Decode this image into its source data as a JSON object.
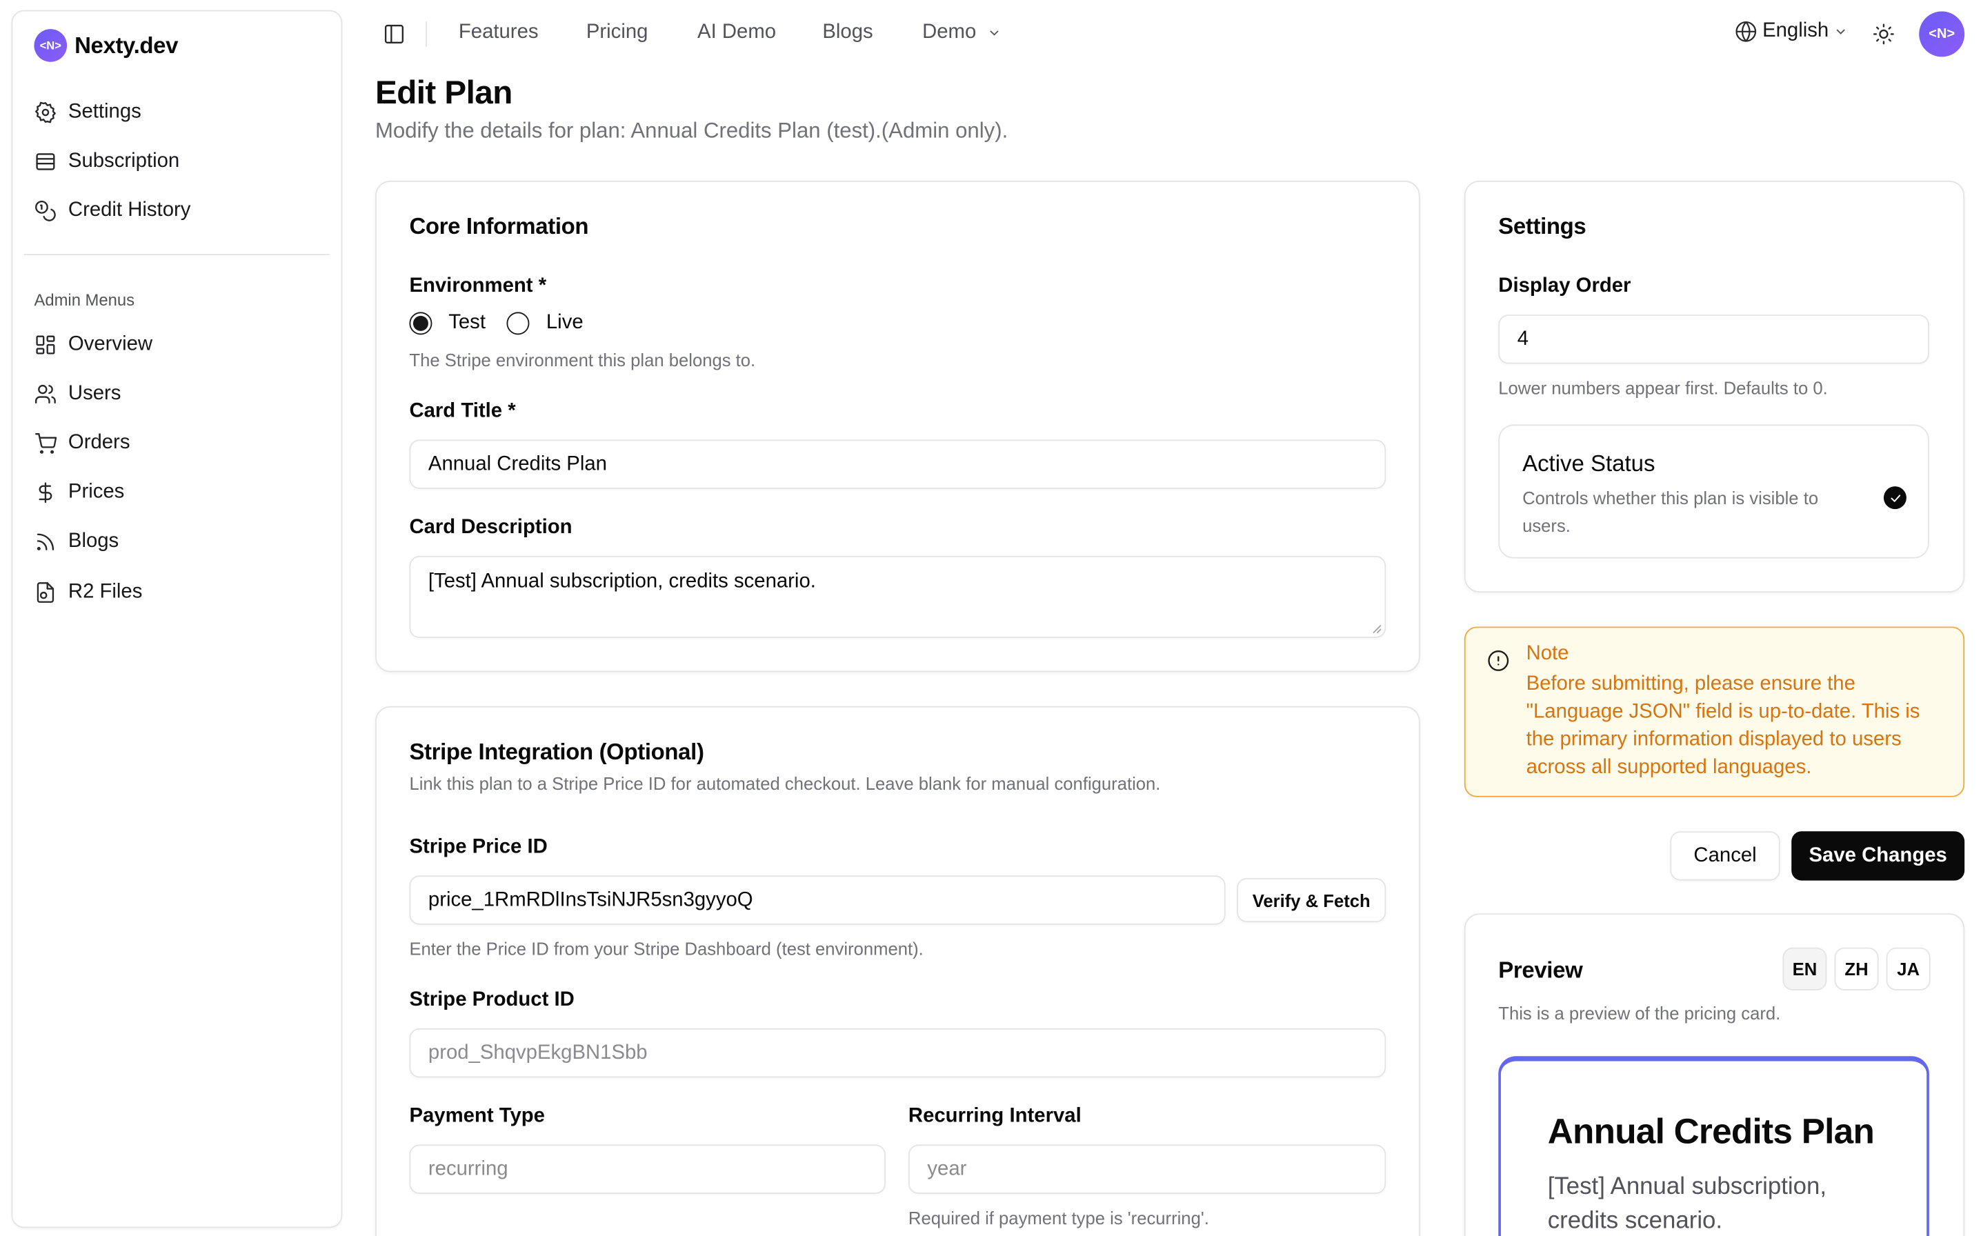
{
  "brand": {
    "name": "Nexty.dev",
    "logo_text": "<N>"
  },
  "sidebar": {
    "items": [
      {
        "label": "Settings",
        "icon": "gear-icon"
      },
      {
        "label": "Subscription",
        "icon": "card-icon"
      },
      {
        "label": "Credit History",
        "icon": "coins-icon"
      }
    ],
    "admin_label": "Admin Menus",
    "admin_items": [
      {
        "label": "Overview",
        "icon": "grid-icon"
      },
      {
        "label": "Users",
        "icon": "users-icon"
      },
      {
        "label": "Orders",
        "icon": "cart-icon"
      },
      {
        "label": "Prices",
        "icon": "dollar-icon"
      },
      {
        "label": "Blogs",
        "icon": "rss-icon"
      },
      {
        "label": "R2 Files",
        "icon": "file-icon"
      }
    ]
  },
  "topnav": {
    "items": [
      "Features",
      "Pricing",
      "AI Demo",
      "Blogs"
    ],
    "demo": "Demo",
    "language": "English",
    "avatar_text": "<N>"
  },
  "page": {
    "title": "Edit Plan",
    "subtitle": "Modify the details for plan: Annual Credits Plan (test).(Admin only)."
  },
  "core": {
    "title": "Core Information",
    "environment_label": "Environment *",
    "env_options": [
      "Test",
      "Live"
    ],
    "env_selected": "Test",
    "environment_help": "The Stripe environment this plan belongs to.",
    "card_title_label": "Card Title *",
    "card_title_value": "Annual Credits Plan",
    "card_desc_label": "Card Description",
    "card_desc_value": "[Test] Annual subscription, credits scenario."
  },
  "stripe": {
    "title": "Stripe Integration (Optional)",
    "description": "Link this plan to a Stripe Price ID for automated checkout. Leave blank for manual configuration.",
    "price_id_label": "Stripe Price ID",
    "price_id_value": "price_1RmRDlInsTsiNJR5sn3gyyoQ",
    "verify_button": "Verify & Fetch",
    "price_id_help": "Enter the Price ID from your Stripe Dashboard (test environment).",
    "product_id_label": "Stripe Product ID",
    "product_id_value": "prod_ShqvpEkgBN1Sbb",
    "payment_type_label": "Payment Type",
    "payment_type_value": "recurring",
    "interval_label": "Recurring Interval",
    "interval_value": "year",
    "interval_help": "Required if payment type is 'recurring'."
  },
  "settings": {
    "title": "Settings",
    "display_order_label": "Display Order",
    "display_order_value": "4",
    "display_order_help": "Lower numbers appear first. Defaults to 0.",
    "active_title": "Active Status",
    "active_desc": "Controls whether this plan is visible to users.",
    "active_checked": true
  },
  "note": {
    "title": "Note",
    "body": "Before submitting, please ensure the \"Language JSON\" field is up-to-date. This is the primary information displayed to users across all supported languages."
  },
  "actions": {
    "cancel": "Cancel",
    "save": "Save Changes"
  },
  "preview": {
    "title": "Preview",
    "langs": [
      "EN",
      "ZH",
      "JA"
    ],
    "active_lang": "EN",
    "description": "This is a preview of the pricing card.",
    "card_title": "Annual Credits Plan",
    "card_desc": "[Test] Annual subscription, credits scenario."
  },
  "colors": {
    "accent": "#6366f1",
    "note_text": "#d9730d",
    "note_border": "#f0a93a",
    "note_bg": "#fffbeb"
  }
}
